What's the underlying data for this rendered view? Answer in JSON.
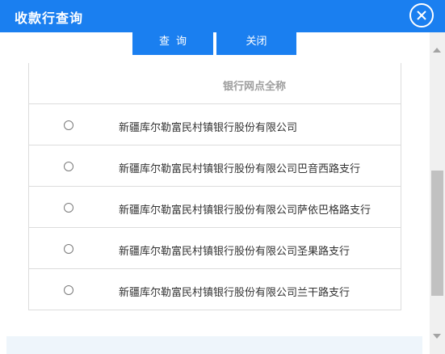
{
  "window": {
    "title": "收款行查询"
  },
  "toolbar": {
    "query_label": "查询",
    "close_label": "关闭"
  },
  "table": {
    "header": "银行网点全称",
    "rows": [
      {
        "name": "新疆库尔勒富民村镇银行股份有限公司",
        "selected": false
      },
      {
        "name": "新疆库尔勒富民村镇银行股份有限公司巴音西路支行",
        "selected": false
      },
      {
        "name": "新疆库尔勒富民村镇银行股份有限公司萨依巴格路支行",
        "selected": false
      },
      {
        "name": "新疆库尔勒富民村镇银行股份有限公司圣果路支行",
        "selected": false
      },
      {
        "name": "新疆库尔勒富民村镇银行股份有限公司兰干路支行",
        "selected": false
      }
    ]
  },
  "icons": {
    "close": "close-circle-icon",
    "scroll_up": "arrow-up-icon",
    "scroll_down": "arrow-down-icon"
  },
  "colors": {
    "primary": "#1a7ff0",
    "border": "#dcdcdc",
    "header_text": "#9e9e9e"
  }
}
